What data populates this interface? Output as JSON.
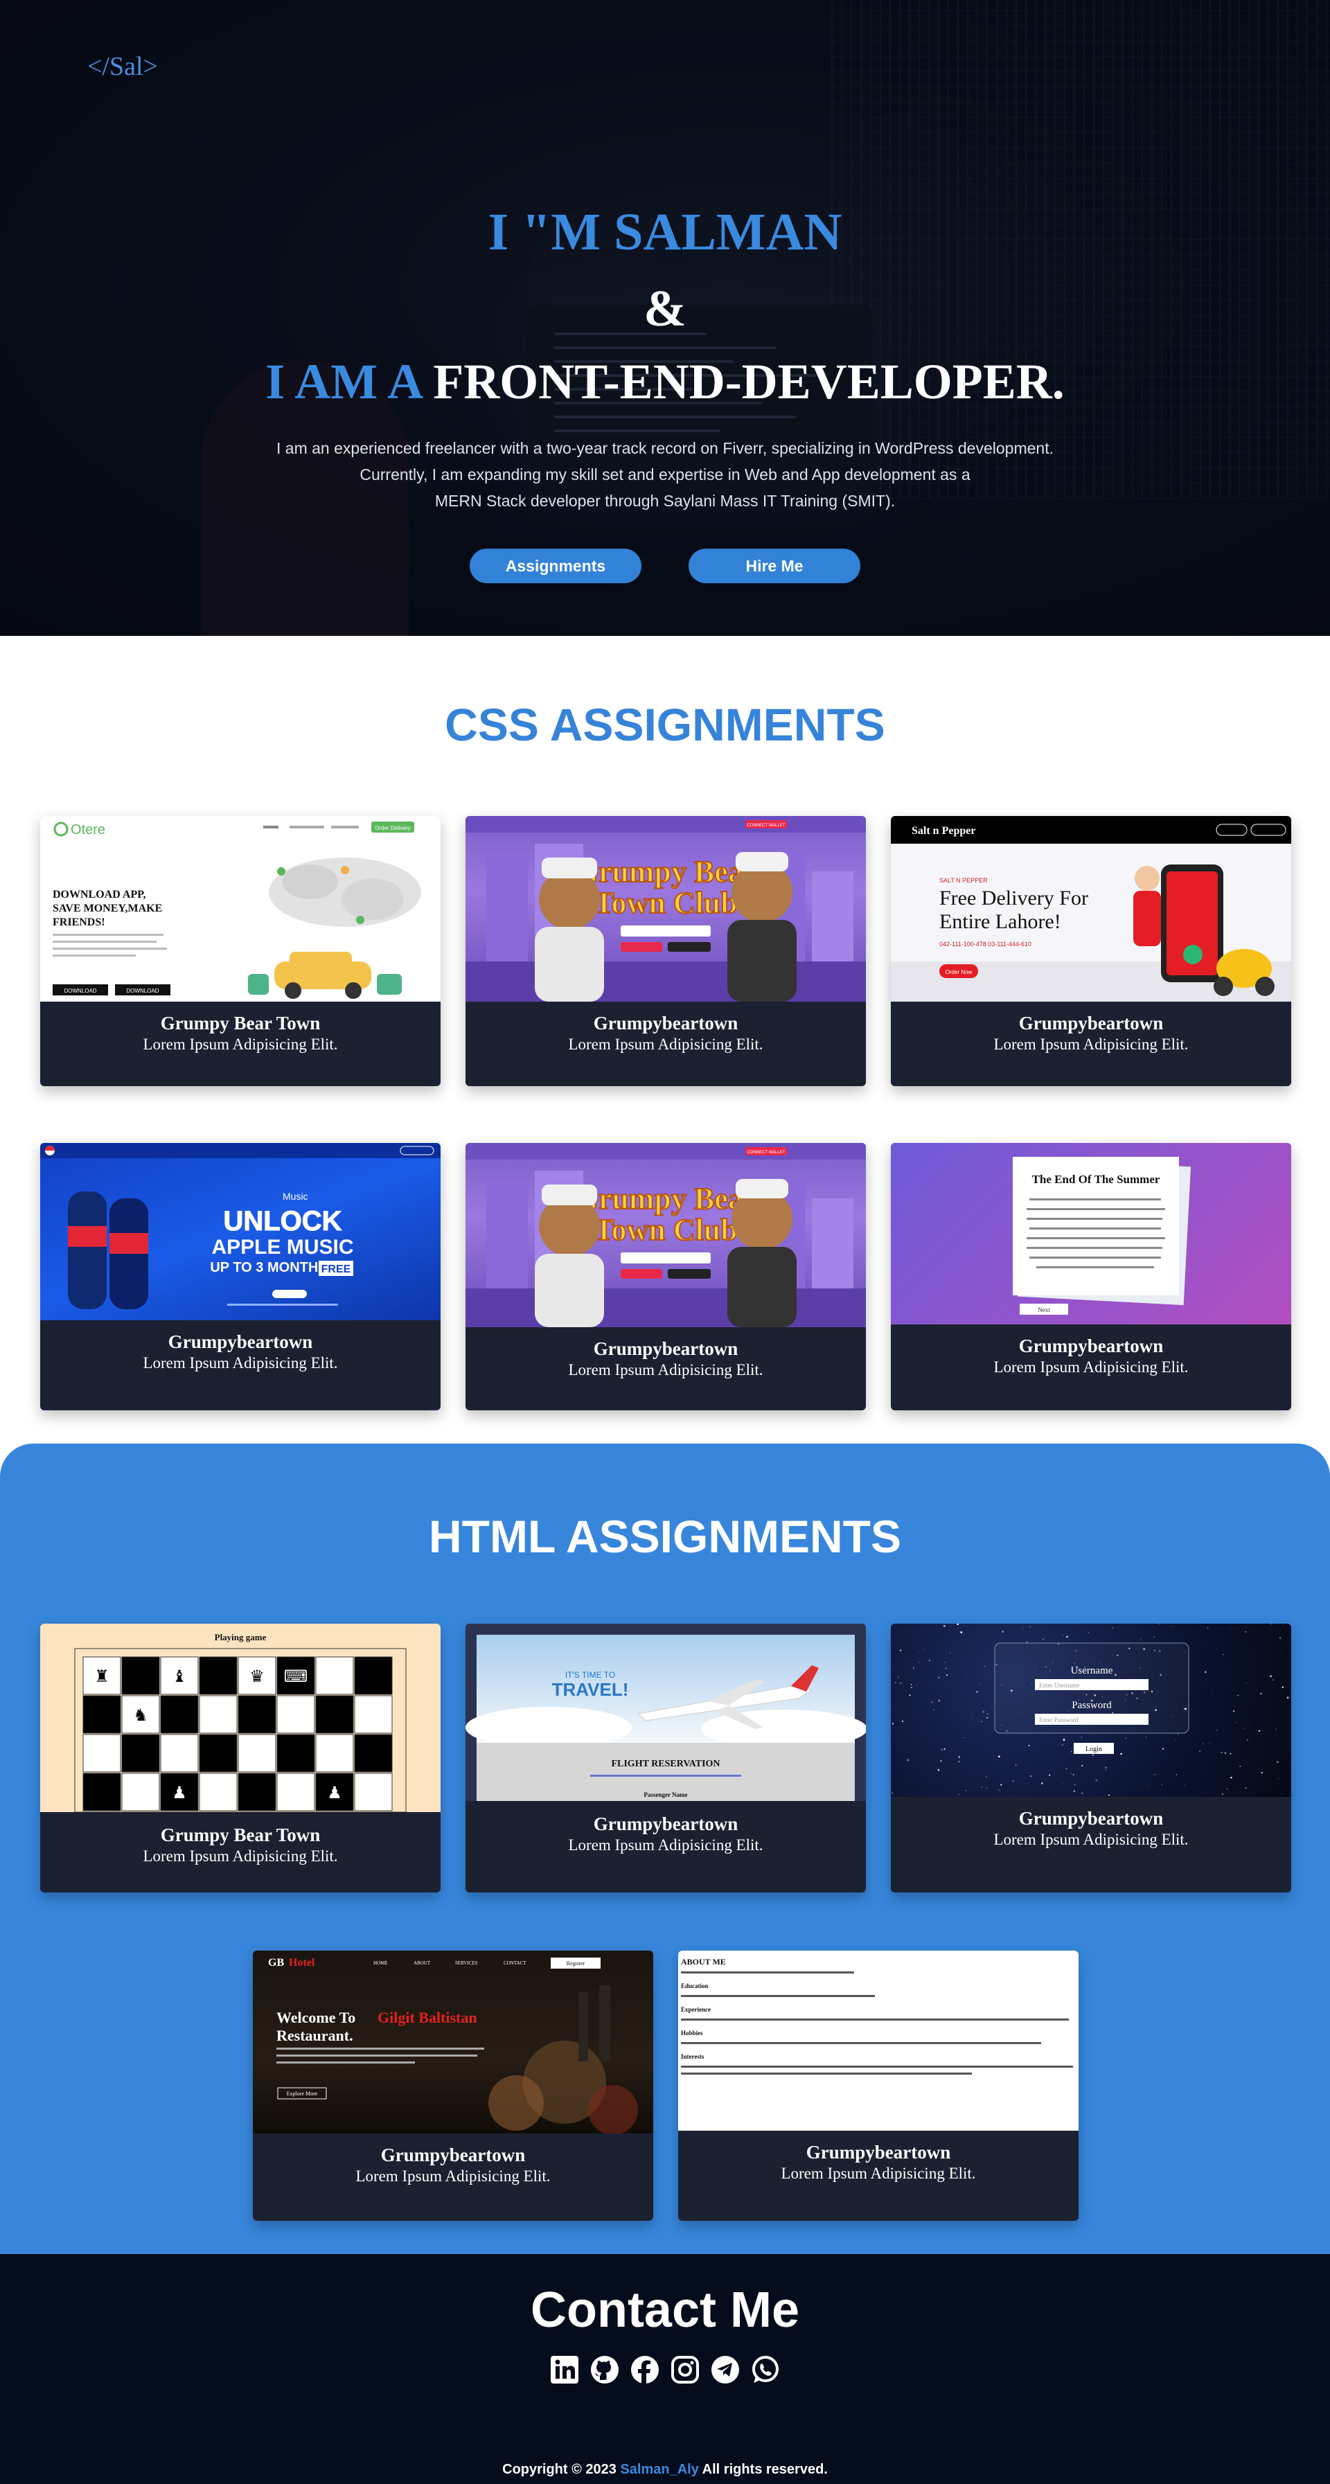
{
  "logo": "</Sal>",
  "hero": {
    "line1": "I \"M SALMAN",
    "line2": "&",
    "line3_blue": "I AM A",
    "line3_white": "FRONT-END-DEVELOPER.",
    "intro_1": "I am an experienced freelancer with a two-year track record on Fiverr, specializing in WordPress development.",
    "intro_2": "Currently, I am expanding my skill set and expertise in Web and App development as a",
    "intro_3": "MERN Stack developer through Saylani Mass IT Training (SMIT).",
    "btn_assignments": "Assignments",
    "btn_hire": "Hire Me"
  },
  "css_section": {
    "title": "CSS ASSIGNMENTS",
    "cards": [
      {
        "title": "Grumpy Bear Town",
        "subtitle": "Lorem Ipsum Adipisicing Elit.",
        "thumb": "otere"
      },
      {
        "title": "Grumpybeartown",
        "subtitle": "Lorem Ipsum Adipisicing Elit.",
        "thumb": "grumpy-bear"
      },
      {
        "title": "Grumpybeartown",
        "subtitle": "Lorem Ipsum Adipisicing Elit.",
        "thumb": "salt-pepper"
      },
      {
        "title": "Grumpybeartown",
        "subtitle": "Lorem Ipsum Adipisicing Elit.",
        "thumb": "pepsi"
      },
      {
        "title": "Grumpybeartown",
        "subtitle": "Lorem Ipsum Adipisicing Elit.",
        "thumb": "grumpy-bear"
      },
      {
        "title": "Grumpybeartown",
        "subtitle": "Lorem Ipsum Adipisicing Elit.",
        "thumb": "end-of-summer"
      }
    ]
  },
  "html_section": {
    "title": "HTML ASSIGNMENTS",
    "cards": [
      {
        "title": "Grumpy Bear Town",
        "subtitle": "Lorem Ipsum Adipisicing Elit.",
        "thumb": "chess"
      },
      {
        "title": "Grumpybeartown",
        "subtitle": "Lorem Ipsum Adipisicing Elit.",
        "thumb": "flight"
      },
      {
        "title": "Grumpybeartown",
        "subtitle": "Lorem Ipsum Adipisicing Elit.",
        "thumb": "login"
      },
      {
        "title": "Grumpybeartown",
        "subtitle": "Lorem Ipsum Adipisicing Elit.",
        "thumb": "hotel"
      },
      {
        "title": "Grumpybeartown",
        "subtitle": "Lorem Ipsum Adipisicing Elit.",
        "thumb": "about-me"
      }
    ]
  },
  "thumbs": {
    "otere": {
      "brand": "Otere",
      "cta": "Order Delivery",
      "headline_1": "DOWNLOAD APP,",
      "headline_2": "SAVE MONEY,MAKE",
      "headline_3": "FRIENDS!",
      "btn_1": "DOWNLOAD",
      "btn_2": "DOWNLOAD"
    },
    "bear": {
      "line_1": "Grumpy Bear",
      "line_2": "Town Club",
      "connect": "CONNECT WALLET"
    },
    "salt": {
      "brand": "Salt n Pepper",
      "tag": "SALT N PEPPER",
      "headline_1": "Free Delivery For",
      "headline_2": "Entire Lahore!",
      "phone": "042-111-100-478  03-111-444-610",
      "btn": "Order Now"
    },
    "pepsi": {
      "unlock": "UNLOCK",
      "apple": "APPLE MUSIC",
      "upto": "UP TO 3 MONTHS",
      "free": "FREE",
      "music": "Music"
    },
    "summer": {
      "title": "The End Of The Summer",
      "btn": "Next"
    },
    "chess": {
      "title": "Playing game"
    },
    "flight": {
      "travel_1": "IT'S TIME TO",
      "travel_2": "TRAVEL!",
      "title": "FLIGHT RESERVATION",
      "passenger": "Passenger Name"
    },
    "login": {
      "username": "Username",
      "password": "Password",
      "user_ph": "Enter Username",
      "pass_ph": "Enter Password",
      "btn": "Login"
    },
    "hotel": {
      "brand_1": "GB",
      "brand_2": "Hotel",
      "nav": [
        "HOME",
        "ABOUT",
        "SERVICES",
        "CONTACT"
      ],
      "register": "Register",
      "welcome_1": "Welcome To",
      "welcome_2": "Gilgit Baltistan",
      "welcome_3": "Restaurant.",
      "explore": "Explore More"
    },
    "about": {
      "title": "ABOUT ME",
      "education": "Education",
      "experience": "Experience",
      "hobbies": "Hobbies",
      "interests": "Interests"
    }
  },
  "contact": {
    "title": "Contact Me",
    "icons": [
      "linkedin-icon",
      "github-icon",
      "facebook-icon",
      "instagram-icon",
      "telegram-icon",
      "whatsapp-icon"
    ]
  },
  "footer": {
    "prefix": "Copyright © 2023 ",
    "brand": "Salman_Aly",
    "suffix": " All rights reserved."
  },
  "colors": {
    "accent": "#3786dc",
    "dark": "#1b2131",
    "footer_bg": "#050c1c"
  }
}
